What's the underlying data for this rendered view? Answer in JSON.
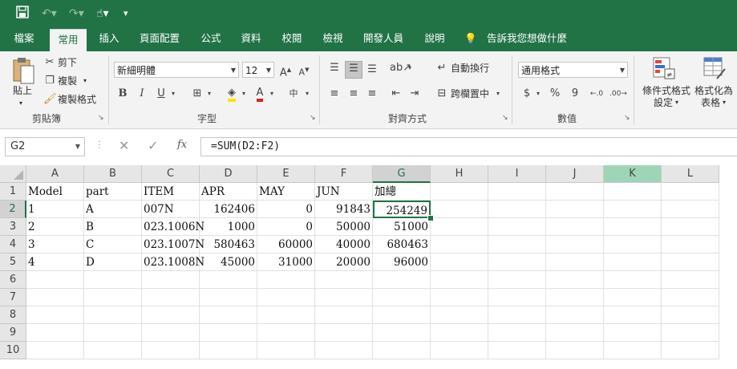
{
  "quick_access": {
    "save_icon": "save-icon",
    "undo_icon": "undo-icon",
    "redo_icon": "redo-icon",
    "touch_icon": "touch-mode-icon",
    "customize_icon": "customize-icon"
  },
  "tabs": [
    "檔案",
    "常用",
    "插入",
    "頁面配置",
    "公式",
    "資料",
    "校閱",
    "檢視",
    "開發人員",
    "說明"
  ],
  "tell_me": "告訴我您想做什麼",
  "ribbon": {
    "clipboard": {
      "paste": "貼上",
      "cut": "剪下",
      "copy": "複製",
      "format_painter": "複製格式",
      "label": "剪貼簿"
    },
    "font": {
      "font_name": "新細明體",
      "font_size": "12",
      "bold": "B",
      "italic": "I",
      "underline": "U",
      "label": "字型"
    },
    "alignment": {
      "wrap_text": "自動換行",
      "merge_center": "跨欄置中",
      "label": "對齊方式"
    },
    "number": {
      "format": "通用格式",
      "currency": "$",
      "percent": "%",
      "comma": "9",
      "label": "數值"
    },
    "styles": {
      "conditional_formatting": "條件式格式",
      "conditional_formatting_2": "設定",
      "format_as_table": "格式化為",
      "format_as_table_2": "表格"
    }
  },
  "formula_bar": {
    "name_box": "G2",
    "formula": "=SUM(D2:F2)"
  },
  "sheet": {
    "columns": [
      "A",
      "B",
      "C",
      "D",
      "E",
      "F",
      "G",
      "H",
      "I",
      "J",
      "K",
      "L"
    ],
    "rows": [
      "1",
      "2",
      "3",
      "4",
      "5",
      "6",
      "7",
      "8",
      "9",
      "10"
    ],
    "cells": [
      [
        "Model",
        "part",
        "ITEM",
        "APR",
        "MAY",
        "JUN",
        "加總"
      ],
      [
        "1",
        "A",
        "007N",
        "162406",
        "0",
        "91843",
        "254249"
      ],
      [
        "2",
        "B",
        "023.1006N",
        "1000",
        "0",
        "50000",
        "51000"
      ],
      [
        "3",
        "C",
        "023.1007N",
        "580463",
        "60000",
        "40000",
        "680463"
      ],
      [
        "4",
        "D",
        "023.1008N",
        "45000",
        "31000",
        "20000",
        "96000"
      ]
    ],
    "active_cell": "G2"
  }
}
